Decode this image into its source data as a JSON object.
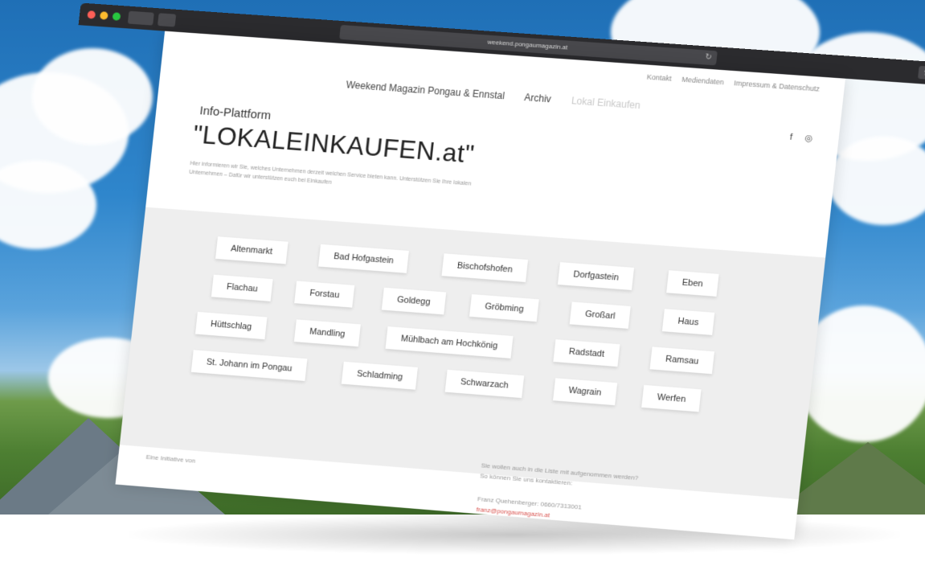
{
  "browser": {
    "url": "weekend.pongaumagazin.at"
  },
  "page": {
    "top_nav": [
      "Kontakt",
      "Mediendaten",
      "Impressum & Datenschutz"
    ],
    "main_nav": {
      "brand": "Weekend Magazin Pongau & Ennstal",
      "archive": "Archiv",
      "current": "Lokal Einkaufen"
    },
    "social_icons": [
      "facebook-icon",
      "instagram-icon"
    ],
    "kicker": "Info-Plattform",
    "headline": "\"LOKALEINKAUFEN.at\"",
    "intro": "Hier informieren wir Sie, welches Unternehmen derzeit welchen Service bieten kann. Unterstützen Sie Ihre lokalen Unternehmen – Dafür wir unterstützen euch bei Einkaufen",
    "towns": [
      "Altenmarkt",
      "Bad Hofgastein",
      "Bischofshofen",
      "Dorfgastein",
      "Eben",
      "Flachau",
      "Forstau",
      "Goldegg",
      "Gröbming",
      "Großarl",
      "Haus",
      "Hüttschlag",
      "Mandling",
      "Mühlbach am Hochkönig",
      "Radstadt",
      "Ramsau",
      "St. Johann im Pongau",
      "Schladming",
      "Schwarzach",
      "Wagrain",
      "Werfen"
    ],
    "footer": {
      "initiative": "Eine Initiative von",
      "listing_line1": "Sie wollen auch in die Liste mit aufgenommen werden?",
      "listing_line2": "So können Sie uns kontaktieren:",
      "contact": "Franz Quehenberger: 0660/7313001",
      "email": "franz@pongaumagazin.at"
    }
  },
  "colors": {
    "sky": "#2f86cc",
    "grass": "#4d7f32",
    "titlebar": "#2b2b2e",
    "grid_bg": "#eeeeee",
    "email": "#d9534f"
  }
}
